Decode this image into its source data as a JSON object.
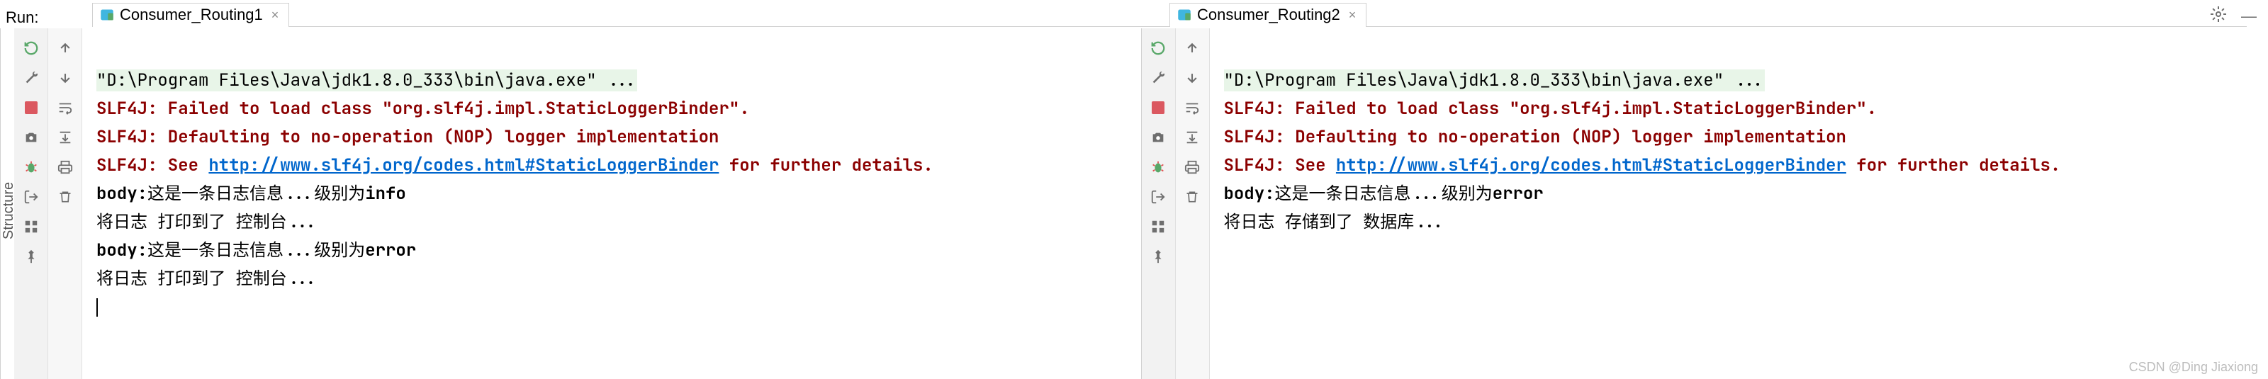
{
  "run_label": "Run:",
  "structure_label": "Structure",
  "tabs": {
    "left": {
      "label": "Consumer_Routing1"
    },
    "right": {
      "label": "Consumer_Routing2"
    }
  },
  "left_console": {
    "cmd": "\"D:\\Program Files\\Java\\jdk1.8.0_333\\bin\\java.exe\" ...",
    "err1": "SLF4J: Failed to load class \"org.slf4j.impl.StaticLoggerBinder\".",
    "err2": "SLF4J: Defaulting to no-operation (NOP) logger implementation",
    "err3a": "SLF4J: See ",
    "err3link": "http://www.slf4j.org/codes.html#StaticLoggerBinder",
    "err3b": " for further details.",
    "l1a": "body:",
    "l1b": "这是一条日志信息...级别为",
    "l1c": "info",
    "l2": "将日志 打印到了 控制台...",
    "l3a": "body:",
    "l3b": "这是一条日志信息...级别为",
    "l3c": "error",
    "l4": "将日志 打印到了 控制台..."
  },
  "right_console": {
    "cmd": "\"D:\\Program Files\\Java\\jdk1.8.0_333\\bin\\java.exe\" ...",
    "err1": "SLF4J: Failed to load class \"org.slf4j.impl.StaticLoggerBinder\".",
    "err2": "SLF4J: Defaulting to no-operation (NOP) logger implementation",
    "err3a": "SLF4J: See ",
    "err3link": "http://www.slf4j.org/codes.html#StaticLoggerBinder",
    "err3b": " for further details.",
    "l1a": "body:",
    "l1b": "这是一条日志信息...级别为",
    "l1c": "error",
    "l2": "将日志 存储到了 数据库..."
  },
  "watermark": "CSDN @Ding Jiaxiong"
}
